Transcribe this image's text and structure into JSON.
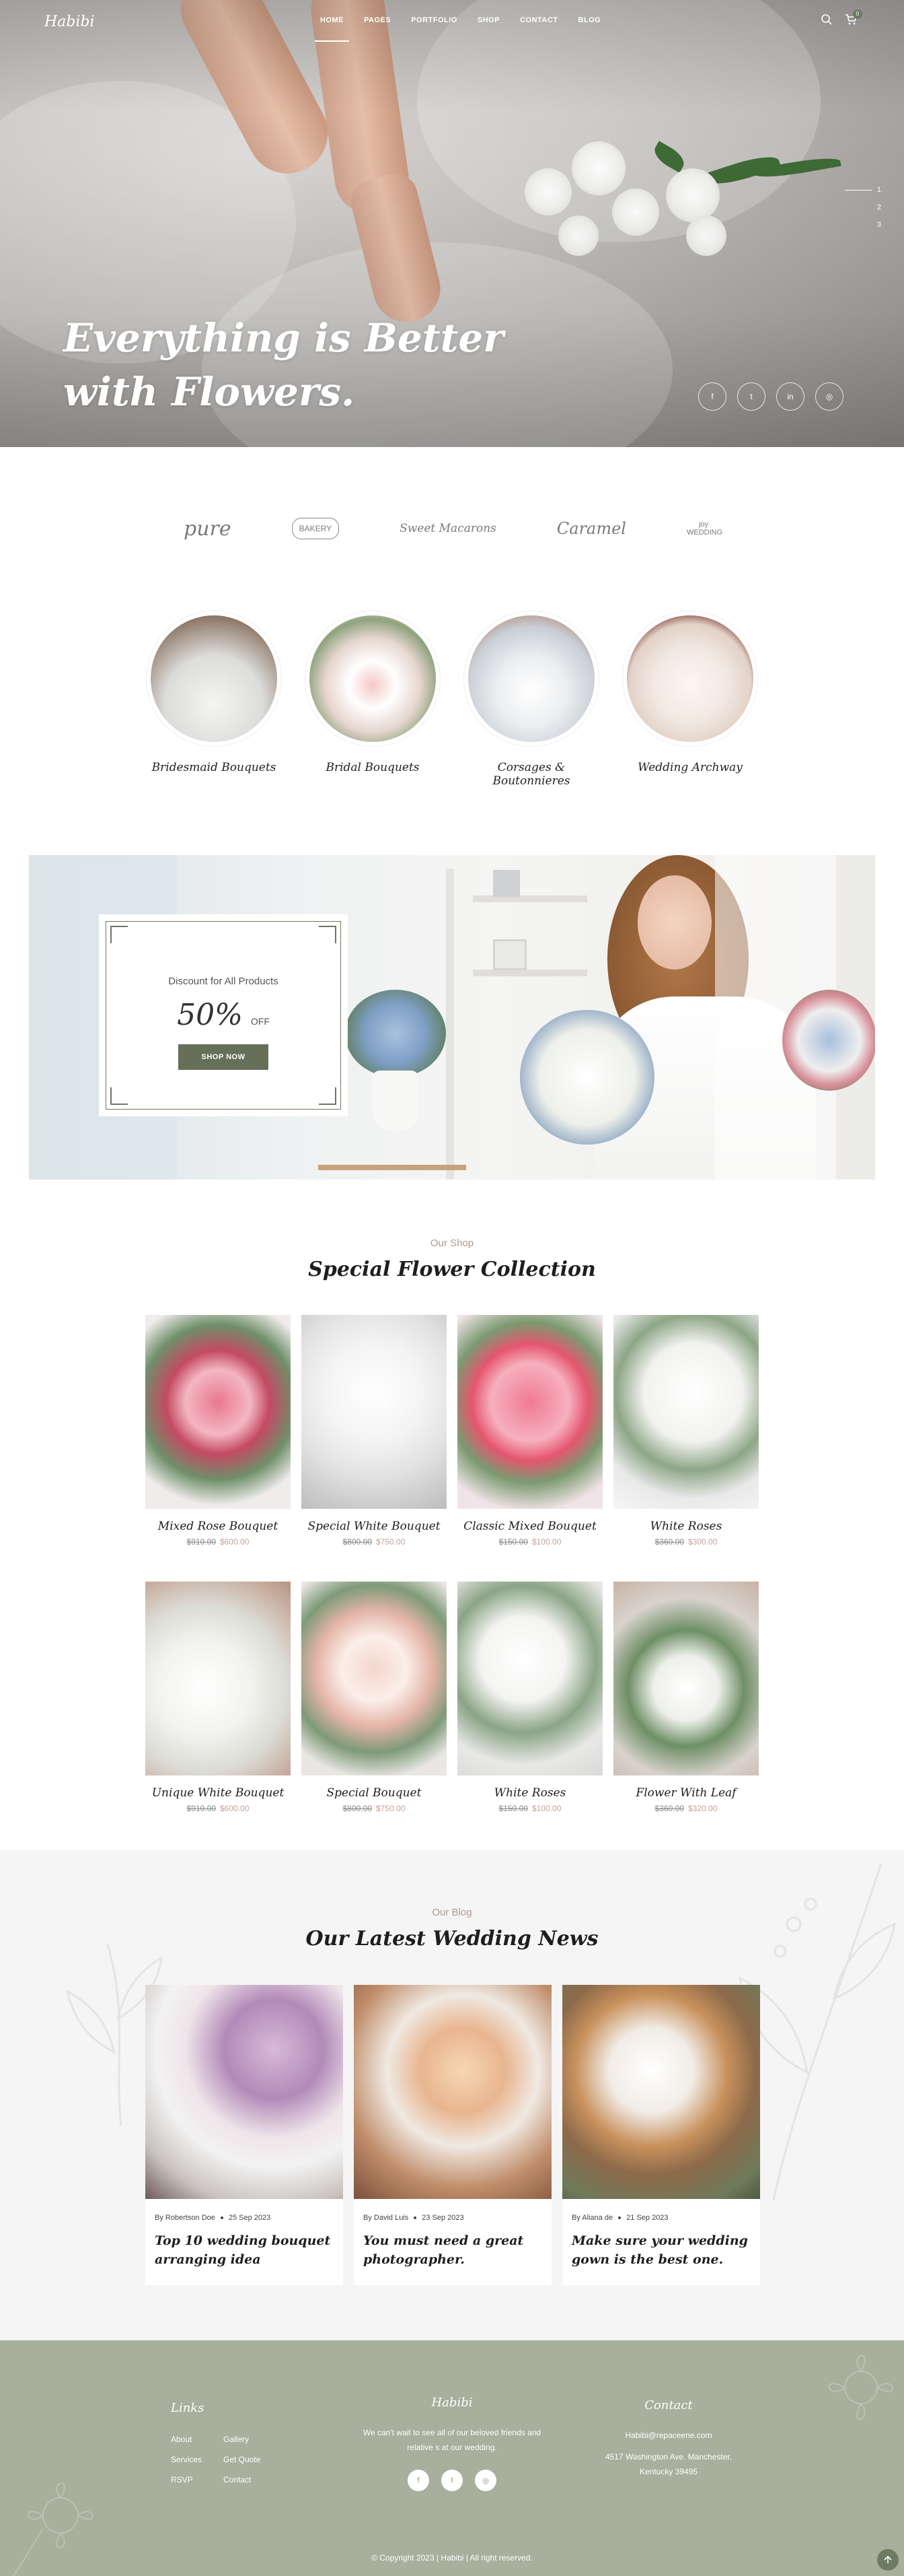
{
  "brand": {
    "logo": "Habibi"
  },
  "nav": {
    "items": [
      {
        "label": "HOME"
      },
      {
        "label": "PAGES"
      },
      {
        "label": "PORTFOLIO"
      },
      {
        "label": "SHOP"
      },
      {
        "label": "CONTACT"
      },
      {
        "label": "BLOG"
      }
    ],
    "cart_count": "0"
  },
  "hero": {
    "title_line1": "Everything is Better",
    "title_line2": "with Flowers.",
    "slides": [
      "1",
      "2",
      "3"
    ],
    "socials": [
      {
        "icon": "facebook-icon",
        "glyph": "f"
      },
      {
        "icon": "twitter-icon",
        "glyph": "t"
      },
      {
        "icon": "linkedin-icon",
        "glyph": "in"
      },
      {
        "icon": "instagram-icon",
        "glyph": "◎"
      }
    ]
  },
  "brands": [
    "pure",
    "BAKERY",
    "Sweet Macarons",
    "Caramel",
    "joy WEDDING"
  ],
  "categories": [
    {
      "name": "Bridesmaid Bouquets"
    },
    {
      "name": "Bridal Bouquets"
    },
    {
      "name": "Corsages & Boutonnieres"
    },
    {
      "name": "Wedding Archway"
    }
  ],
  "promo": {
    "subtitle": "Discount for All Products",
    "percent": "50%",
    "off": "OFF",
    "button": "SHOP NOW"
  },
  "shop": {
    "tag": "Our Shop",
    "title": "Special Flower Collection",
    "products": [
      {
        "name": "Mixed Rose Bouquet",
        "old": "$910.00",
        "new": "$600.00"
      },
      {
        "name": "Special White Bouquet",
        "old": "$800.00",
        "new": "$750.00"
      },
      {
        "name": "Classic Mixed Bouquet",
        "old": "$150.00",
        "new": "$100.00"
      },
      {
        "name": "White Roses",
        "old": "$360.00",
        "new": "$300.00"
      },
      {
        "name": "Unique White Bouquet",
        "old": "$910.00",
        "new": "$600.00"
      },
      {
        "name": "Special Bouquet",
        "old": "$800.00",
        "new": "$750.00"
      },
      {
        "name": "White Roses",
        "old": "$150.00",
        "new": "$100.00"
      },
      {
        "name": "Flower With Leaf",
        "old": "$360.00",
        "new": "$320.00"
      }
    ]
  },
  "blog": {
    "tag": "Our Blog",
    "title": "Our Latest Wedding News",
    "posts": [
      {
        "author": "By Robertson Doe",
        "date": "25 Sep 2023",
        "title": "Top 10 wedding bouquet arranging idea"
      },
      {
        "author": "By David Luis",
        "date": "23 Sep 2023",
        "title": "You must need a great photographer."
      },
      {
        "author": "By Aliana de",
        "date": "21 Sep 2023",
        "title": "Make sure your wedding gown is the best one."
      }
    ]
  },
  "footer": {
    "links_title": "Links",
    "links_col1": [
      "About",
      "Services",
      "RSVP"
    ],
    "links_col2": [
      "Gallery",
      "Get Quote",
      "Contact"
    ],
    "brand_title": "Habibi",
    "brand_text_line1": "We can't wait to see all of our beloved friends and",
    "brand_text_line2": "relative s at our wedding.",
    "contact_title": "Contact",
    "email": "Habibi@repaceene.com",
    "address_line1": "4517 Washington Ave. Manchester,",
    "address_line2": "Kentucky 39495",
    "copyright": "© Copyright 2023 | Habibi | All right reserved."
  },
  "colors": {
    "accent": "#667058",
    "footer_bg": "#a8af9c",
    "price": "#c3a29a",
    "tag": "#b49890"
  }
}
